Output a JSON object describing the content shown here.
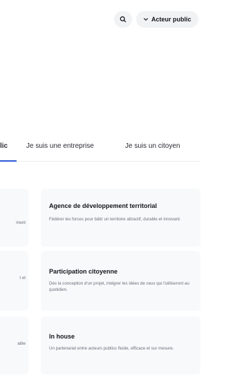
{
  "header": {
    "actor_label": "Acteur public"
  },
  "tabs": [
    {
      "label": "lic"
    },
    {
      "label": "Je suis une entreprise"
    },
    {
      "label": "Je suis un citoyen"
    }
  ],
  "cards": [
    {
      "left_fragment": "ment",
      "title": "Agence de développement territorial",
      "description": "Fédérer les forces pour bâtir un territoire attractif, durable et innovant."
    },
    {
      "left_fragment": "t et",
      "title": "Participation citoyenne",
      "description": "Dès la conception d'un projet, intégrer les idées de ceux qui l'utiliseront au quotidien."
    },
    {
      "left_fragment": "able",
      "title": "In house",
      "description": "Un partenariat entre acteurs publics fluide, efficace et sur mesure."
    }
  ],
  "colors": {
    "accent": "#2a5ad7",
    "card_background": "#f8f9fb",
    "pill_background": "#f1f2f4"
  }
}
